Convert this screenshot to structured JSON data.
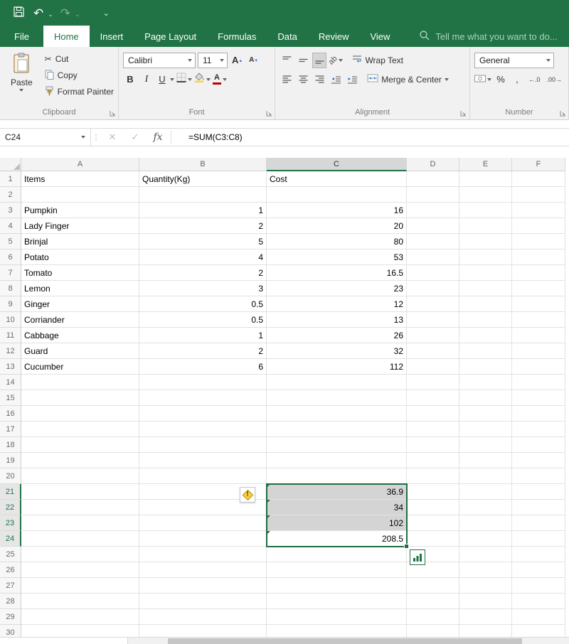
{
  "colors": {
    "excel_green": "#217346",
    "ribbon_bg": "#f1f1f1",
    "selection_fill": "#d4d4d4",
    "selection_border": "#1f6e43"
  },
  "quick_access": {
    "undo_glyph": "↶",
    "redo_glyph": "↷",
    "customize_glyph": "⌄"
  },
  "tabs": {
    "file": "File",
    "items": [
      "Home",
      "Insert",
      "Page Layout",
      "Formulas",
      "Data",
      "Review",
      "View"
    ],
    "active": "Home",
    "tell_me": "Tell me what you want to do..."
  },
  "ribbon": {
    "clipboard": {
      "label": "Clipboard",
      "paste": "Paste",
      "cut": "Cut",
      "copy": "Copy",
      "format_painter": "Format Painter"
    },
    "font": {
      "label": "Font",
      "family": "Calibri",
      "size": "11",
      "bold": "B",
      "italic": "I",
      "underline": "U",
      "grow": "A",
      "shrink": "A"
    },
    "alignment": {
      "label": "Alignment",
      "orientation": "ab",
      "wrap_text": "Wrap Text",
      "merge_center": "Merge & Center"
    },
    "number": {
      "label": "Number",
      "format": "General",
      "percent": "%",
      "comma": ",",
      "increase_decimal": "←.0",
      "decrease_decimal": ".00→"
    }
  },
  "formula_bar": {
    "name_box": "C24",
    "cancel": "✕",
    "enter": "✓",
    "fx": "fx",
    "formula": "=SUM(C3:C8)"
  },
  "sheet": {
    "columns": [
      "A",
      "B",
      "C",
      "D",
      "E",
      "F"
    ],
    "selected_column": "C",
    "active_cell": "C24",
    "selected_range": "C21:C24",
    "selected_row_headers": [
      21,
      22,
      23,
      24
    ],
    "rows": [
      {
        "n": 1,
        "A": "Items",
        "B": "Quantity(Kg)",
        "C": "Cost"
      },
      {
        "n": 2
      },
      {
        "n": 3,
        "A": "Pumpkin",
        "B": 1,
        "C": 16
      },
      {
        "n": 4,
        "A": "Lady Finger",
        "B": 2,
        "C": 20
      },
      {
        "n": 5,
        "A": "Brinjal",
        "B": 5,
        "C": 80
      },
      {
        "n": 6,
        "A": "Potato",
        "B": 4,
        "C": 53
      },
      {
        "n": 7,
        "A": "Tomato",
        "B": 2,
        "C": 16.5
      },
      {
        "n": 8,
        "A": "Lemon",
        "B": 3,
        "C": 23
      },
      {
        "n": 9,
        "A": "Ginger",
        "B": 0.5,
        "C": 12
      },
      {
        "n": 10,
        "A": "Corriander",
        "B": 0.5,
        "C": 13
      },
      {
        "n": 11,
        "A": "Cabbage",
        "B": 1,
        "C": 26
      },
      {
        "n": 12,
        "A": "Guard",
        "B": 2,
        "C": 32
      },
      {
        "n": 13,
        "A": "Cucumber",
        "B": 6,
        "C": 112
      },
      {
        "n": 14
      },
      {
        "n": 15
      },
      {
        "n": 16
      },
      {
        "n": 17
      },
      {
        "n": 18
      },
      {
        "n": 19
      },
      {
        "n": 20
      },
      {
        "n": 21,
        "C": 36.9
      },
      {
        "n": 22,
        "C": 34
      },
      {
        "n": 23,
        "C": 102
      },
      {
        "n": 24,
        "C": 208.5
      },
      {
        "n": 25
      },
      {
        "n": 26
      },
      {
        "n": 27
      },
      {
        "n": 28
      },
      {
        "n": 29
      },
      {
        "n": 30
      }
    ]
  }
}
